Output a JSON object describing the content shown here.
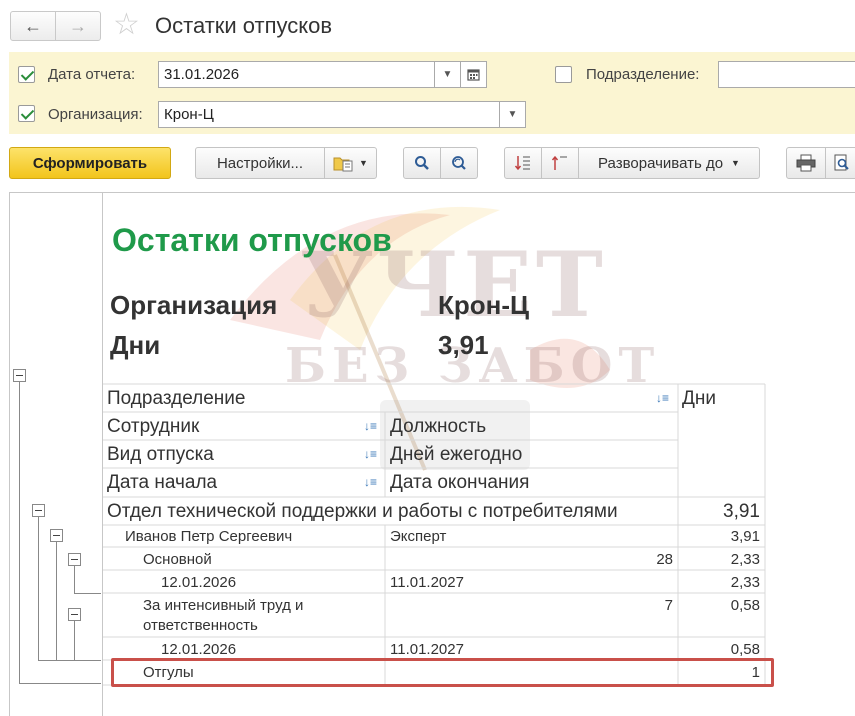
{
  "window": {
    "title": "Остатки отпусков",
    "back_icon": "arrow-left-icon",
    "forward_icon": "arrow-right-icon",
    "favorite_icon": "star-icon"
  },
  "params": {
    "report_date": {
      "label": "Дата отчета:",
      "value": "31.01.2026",
      "checked": true
    },
    "department": {
      "label": "Подразделение:",
      "value": "",
      "checked": false
    },
    "organization": {
      "label": "Организация:",
      "value": "Крон-Ц",
      "checked": true
    }
  },
  "toolbar": {
    "generate_label": "Сформировать",
    "settings_label": "Настройки...",
    "expand_label": "Разворачивать до"
  },
  "report": {
    "title": "Остатки отпусков",
    "org_label": "Организация",
    "org_value": "Крон-Ц",
    "days_label": "Дни",
    "days_value": "3,91",
    "headers": {
      "department": "Подразделение",
      "days": "Дни",
      "employee": "Сотрудник",
      "position": "Должность",
      "vacation_type": "Вид отпуска",
      "annual_days": "Дней ежегодно",
      "start_date": "Дата начала",
      "end_date": "Дата окончания"
    },
    "rows": {
      "dept": {
        "name": "Отдел технической поддержки и работы с потребителями",
        "days": "3,91"
      },
      "employee": {
        "name": "Иванов Петр Сергеевич",
        "position": "Эксперт",
        "days": "3,91"
      },
      "basic": {
        "name": "Основной",
        "annual": "28",
        "days": "2,33"
      },
      "basic_period": {
        "start": "12.01.2026",
        "end": "11.01.2027",
        "days": "2,33"
      },
      "intensive": {
        "name_line1": "За интенсивный труд и",
        "name_line2": "ответственность",
        "annual": "7",
        "days": "0,58"
      },
      "intensive_period": {
        "start": "12.01.2026",
        "end": "11.01.2027",
        "days": "0,58"
      },
      "timeoff": {
        "name": "Отгулы",
        "days": "1"
      }
    },
    "watermark": {
      "line1": "УЧЕТ",
      "line2": "БЕЗ ЗАБОТ"
    }
  },
  "colors": {
    "title_green": "#1f9a4a",
    "param_bg": "#fbf5d2",
    "primary_button": "#f2c51c",
    "highlight_red": "#c9504a"
  }
}
